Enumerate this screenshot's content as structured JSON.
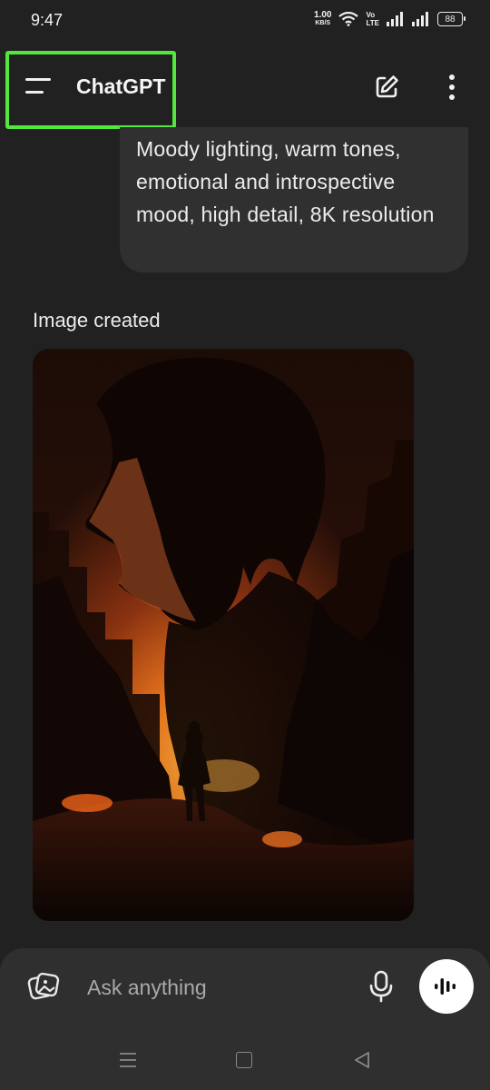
{
  "status_bar": {
    "time": "9:47",
    "speed_value": "1.00",
    "speed_unit": "KB/S",
    "volte_line1": "Vo",
    "volte_line2": "LTE",
    "battery": "88"
  },
  "header": {
    "title": "ChatGPT",
    "menu_icon": "menu-icon",
    "new_chat_icon": "new-chat-edit-icon",
    "more_icon": "more-vertical-icon",
    "highlight_color": "#53e63d"
  },
  "conversation": {
    "user_message_visible": "Moody lighting, warm tones, emotional and introspective mood, high detail, 8K resolution",
    "assistant_status": "Image created",
    "image_icon": "generated-image"
  },
  "composer": {
    "placeholder": "Ask anything",
    "attach_icon": "image-attach-icon",
    "mic_icon": "microphone-icon",
    "voice_icon": "voice-mode-icon"
  },
  "navigation": {
    "recent_icon": "recent-apps-icon",
    "home_icon": "home-icon",
    "back_icon": "back-icon"
  },
  "colors": {
    "background": "#212121",
    "bubble": "#303030",
    "composer": "#2f2f2f",
    "accent_fire": "#e8871e"
  }
}
